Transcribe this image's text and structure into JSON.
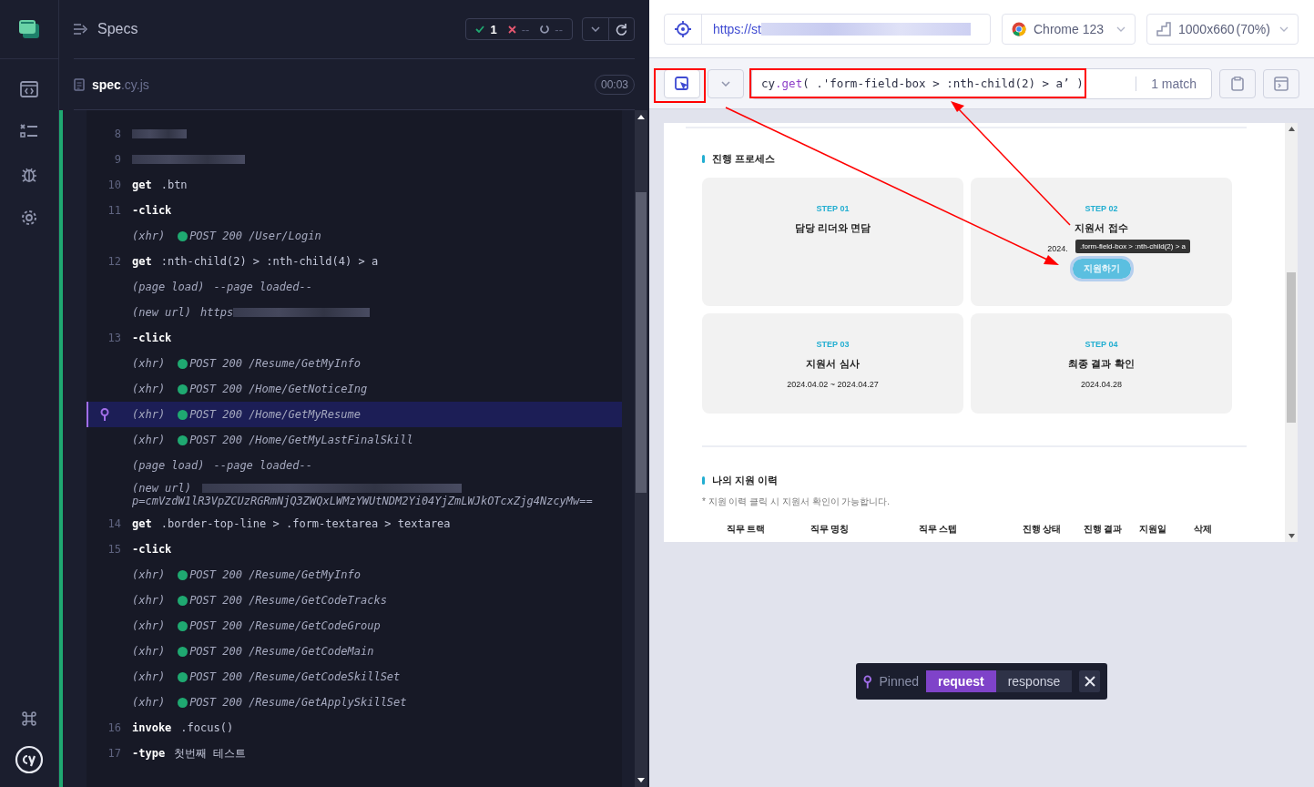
{
  "reporter": {
    "title": "Specs",
    "stats": {
      "passed": "1",
      "failed": "--",
      "pending": "--"
    },
    "spec": {
      "name": "spec",
      "ext": ".cy.js",
      "duration": "00:03"
    },
    "log": [
      {
        "kind": "redacted",
        "number": "8",
        "pinned": false
      },
      {
        "kind": "redacted",
        "number": "9",
        "pinned": false
      },
      {
        "kind": "command",
        "number": "10",
        "name": "get",
        "message": ".btn",
        "pinned": false
      },
      {
        "kind": "command",
        "number": "11",
        "name": "-click",
        "pinned": false
      },
      {
        "kind": "xhr",
        "label": "(xhr)",
        "message": "POST 200 /User/Login",
        "pinned": false
      },
      {
        "kind": "command",
        "number": "12",
        "name": "get",
        "message": ":nth-child(2) > :nth-child(4) > a",
        "pinned": false
      },
      {
        "kind": "event",
        "label": "(page load)",
        "message": "--page loaded--",
        "pinned": false
      },
      {
        "kind": "url",
        "label": "(new url)",
        "message": "https",
        "pinned": false
      },
      {
        "kind": "command",
        "number": "13",
        "name": "-click",
        "pinned": false
      },
      {
        "kind": "xhr",
        "label": "(xhr)",
        "message": "POST 200 /Resume/GetMyInfo",
        "pinned": false
      },
      {
        "kind": "xhr",
        "label": "(xhr)",
        "message": "POST 200 /Home/GetNoticeIng",
        "pinned": false
      },
      {
        "kind": "xhr",
        "label": "(xhr)",
        "message": "POST 200 /Home/GetMyResume",
        "pinned": true
      },
      {
        "kind": "xhr",
        "label": "(xhr)",
        "message": "POST 200 /Home/GetMyLastFinalSkill",
        "pinned": false
      },
      {
        "kind": "event",
        "label": "(page load)",
        "message": "--page loaded--",
        "pinned": false
      },
      {
        "kind": "url_wrapped",
        "label": "(new url)",
        "message": "p=cmVzdW1lR3VpZCUzRGRmNjQ3ZWQxLWMzYWUtNDM2Yi04YjZmLWJkOTcxZjg4NzcyMw==",
        "pinned": false
      },
      {
        "kind": "command",
        "number": "14",
        "name": "get",
        "message": ".border-top-line > .form-textarea > textarea",
        "pinned": false
      },
      {
        "kind": "command",
        "number": "15",
        "name": "-click",
        "pinned": false
      },
      {
        "kind": "xhr",
        "label": "(xhr)",
        "message": "POST 200 /Resume/GetMyInfo",
        "pinned": false
      },
      {
        "kind": "xhr",
        "label": "(xhr)",
        "message": "POST 200 /Resume/GetCodeTracks",
        "pinned": false
      },
      {
        "kind": "xhr",
        "label": "(xhr)",
        "message": "POST 200 /Resume/GetCodeGroup",
        "pinned": false
      },
      {
        "kind": "xhr",
        "label": "(xhr)",
        "message": "POST 200 /Resume/GetCodeMain",
        "pinned": false
      },
      {
        "kind": "xhr",
        "label": "(xhr)",
        "message": "POST 200 /Resume/GetCodeSkillSet",
        "pinned": false
      },
      {
        "kind": "xhr",
        "label": "(xhr)",
        "message": "POST 200 /Resume/GetApplySkillSet",
        "pinned": false
      },
      {
        "kind": "command",
        "number": "16",
        "name": "invoke",
        "message": ".focus()",
        "pinned": false
      },
      {
        "kind": "command",
        "number": "17",
        "name": "-type",
        "message": "첫번째 테스트",
        "pinned": false
      }
    ]
  },
  "browser": {
    "url": "https://st",
    "browser": "Chrome 123",
    "viewport": "1000x660",
    "scale": "(70%)"
  },
  "selector_playground": {
    "object": "cy",
    "method": ".get",
    "selector": "( .'form-field-box > :nth-child(2) > a’ )",
    "matches": "1 match"
  },
  "page": {
    "process": {
      "title": "진행 프로세스",
      "steps": [
        {
          "step": "STEP 01",
          "title": "담당 리더와 면담"
        },
        {
          "step": "STEP 02",
          "title": "지원서 접수",
          "date": "2024.",
          "button": "지원하기",
          "highlighted": true,
          "tooltip": ".form-field-box > :nth-child(2) > a"
        },
        {
          "step": "STEP 03",
          "title": "지원서 심사",
          "date": "2024.04.02 ~ 2024.04.27"
        },
        {
          "step": "STEP 04",
          "title": "최종 결과 확인",
          "date": "2024.04.28"
        }
      ]
    },
    "history": {
      "title": "나의 지원 이력",
      "note": "* 지원 이력 클릭 시 지원서 확인이 가능합니다.",
      "columns": [
        "직무 트랙",
        "직무 명칭",
        "직무 스텝",
        "진행 상태",
        "진행 결과",
        "지원일",
        "삭제"
      ]
    }
  },
  "pinned_bar": {
    "label": "Pinned",
    "tabs": [
      {
        "label": "request",
        "selected": true
      },
      {
        "label": "response",
        "selected": false
      }
    ]
  }
}
